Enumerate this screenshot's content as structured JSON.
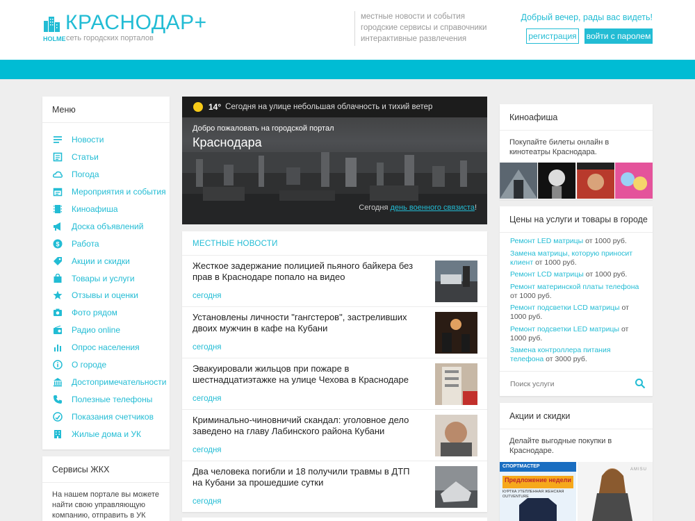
{
  "header": {
    "logo_title": "КРАСНОДАР+",
    "logo_holme": "HOLME",
    "logo_sub": "сеть городских порталов",
    "taglines": [
      "местные новости и события",
      "городские сервисы и справочники",
      "интерактивные развлечения"
    ],
    "greeting": "Добрый вечер, рады вас видеть!",
    "register": "регистрация",
    "login": "войти с паролем"
  },
  "colors": {
    "accent": "#22bcd4",
    "bar": "#00bcd4"
  },
  "menu": {
    "title": "Меню",
    "items": [
      {
        "label": "Новости",
        "icon": "news-list-icon"
      },
      {
        "label": "Статьи",
        "icon": "article-icon"
      },
      {
        "label": "Погода",
        "icon": "weather-icon"
      },
      {
        "label": "Мероприятия и события",
        "icon": "calendar-icon"
      },
      {
        "label": "Киноафиша",
        "icon": "film-icon"
      },
      {
        "label": "Доска объявлений",
        "icon": "megaphone-icon"
      },
      {
        "label": "Работа",
        "icon": "dollar-icon"
      },
      {
        "label": "Акции и скидки",
        "icon": "tag-icon"
      },
      {
        "label": "Товары и услуги",
        "icon": "bag-icon"
      },
      {
        "label": "Отзывы и оценки",
        "icon": "star-icon"
      },
      {
        "label": "Фото рядом",
        "icon": "photo-icon"
      },
      {
        "label": "Радио online",
        "icon": "radio-icon"
      },
      {
        "label": "Опрос населения",
        "icon": "poll-icon"
      },
      {
        "label": "О городе",
        "icon": "info-icon"
      },
      {
        "label": "Достопримечательности",
        "icon": "museum-icon"
      },
      {
        "label": "Полезные телефоны",
        "icon": "phone-icon"
      },
      {
        "label": "Показания счетчиков",
        "icon": "meter-icon"
      },
      {
        "label": "Жилые дома и УК",
        "icon": "building-icon"
      }
    ]
  },
  "zhkh": {
    "title": "Сервисы ЖКХ",
    "text": "На нашем портале вы можете найти свою управляющую компанию, отправить в УК показания счетчиков и"
  },
  "hero": {
    "temperature": "14°",
    "weather": "Сегодня на улице небольшая облачность и тихий ветер",
    "line1": "Добро пожаловать на городской портал",
    "line2": "Краснодара",
    "foot_prefix": "Сегодня ",
    "foot_link": "день военного связиста",
    "foot_suffix": "!"
  },
  "news": {
    "title": "МЕСТНЫЕ НОВОСТИ",
    "items": [
      {
        "title": "Жесткое задержание полицией пьяного байкера без прав в Краснодаре попало на видео",
        "date": "сегодня"
      },
      {
        "title": "Установлены личности \"гангстеров\", застреливших двоих мужчин в кафе на Кубани",
        "date": "сегодня"
      },
      {
        "title": "Эвакуировали жильцов при пожаре в шестнадцатиэтажке на улице Чехова в Краснодаре",
        "date": "сегодня"
      },
      {
        "title": "Криминально-чиновничий скандал: уголовное дело заведено на главу Лабинского района Кубани",
        "date": "сегодня"
      },
      {
        "title": "Два человека погибли и 18 получили травмы в ДТП на Кубани за прошедшие сутки",
        "date": "сегодня"
      }
    ]
  },
  "kino": {
    "title": "Киноафиша",
    "text": "Покупайте билеты онлайн в кинотеатры Краснодара."
  },
  "prices": {
    "title": "Цены на услуги и товары в городе",
    "items": [
      {
        "link": "Ремонт LED матрицы",
        "price": " от 1000 руб."
      },
      {
        "link": "Замена матрицы, которую приносит клиент",
        "price": " от 1000 руб."
      },
      {
        "link": "Ремонт LCD матрицы",
        "price": " от 1000 руб."
      },
      {
        "link": "Ремонт материнской платы телефона",
        "price": " от 1000 руб."
      },
      {
        "link": "Ремонт подсветки LCD матрицы",
        "price": " от 1000 руб."
      },
      {
        "link": "Ремонт подсветки LED матрицы",
        "price": " от 1000 руб."
      },
      {
        "link": "Замена контроллера питания телефона",
        "price": " от 3000 руб."
      }
    ],
    "search_placeholder": "Поиск услуги"
  },
  "sales": {
    "title": "Акции и скидки",
    "text": "Делайте выгодные покупки в Краснодаре.",
    "banner1_top": "СПОРТМАСТЕР",
    "banner1_mid": "Предложение недели",
    "banner1_sub": "КУРТКА УТЕПЛЕННАЯ ЖЕНСКАЯ OUTVENTURE",
    "banner2_brand": "AMISU"
  }
}
